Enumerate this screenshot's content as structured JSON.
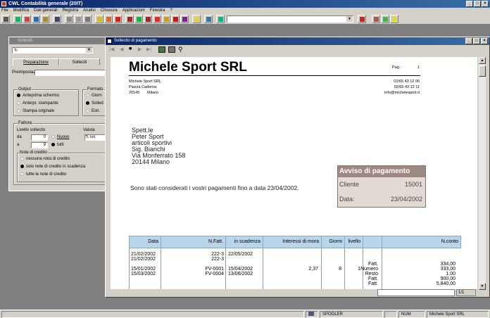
{
  "app": {
    "title": "CWL Contabilità generale (20IT)",
    "menu": [
      "File",
      "Modifica",
      "Dati generali",
      "Registra",
      "Analisi",
      "Chiusura",
      "Applicazioni",
      "Finestra",
      "?"
    ]
  },
  "statusbar": {
    "spooler": "SPOOLER",
    "num": "NUM",
    "company": "Michele Sport SRL"
  },
  "solleciti": {
    "title": "Solleciti",
    "tabs": [
      "Preparazione",
      "Solleciti"
    ],
    "preimpost_label": "Preimpostaz.",
    "output_label": "Output",
    "output_options": [
      "Anteprima schermo",
      "Anterpr. stampante",
      "Stampa originale"
    ],
    "formato_label": "Formato",
    "formato_options": [
      "Giorn",
      "Solled",
      "Estr."
    ],
    "fattura_label": "Fattura",
    "livello_label": "Livello sollecito",
    "valuta_label": "Valuta",
    "da_label": "da",
    "da_value": "0",
    "a_label": "a",
    "a_value": "9",
    "nuovo_label": "Nuovo",
    "tutti_label": "tutti",
    "valuta_value": "TL",
    "valuta_tutt": "tutt",
    "note_label": "Note di credito",
    "note_options": [
      "nessuna nota di credito",
      "solo note di credito in scadenza",
      "tutte le note di credito"
    ]
  },
  "doc": {
    "window_title": "Sollecito di pagamento",
    "company": "Michele Sport SRL",
    "pag_label": "Pag.:",
    "pag_value": "1",
    "addr1": "Michele Sport SRL",
    "addr2": "Piazza Cadorna",
    "addr3a": "20145",
    "addr3b": "Milano",
    "phone1": "02/65 43 12 06",
    "phone2": "02/65 43 12 11",
    "email": "info@michelesport.it",
    "recipient": [
      "Spett.le",
      "Peter Sport",
      "articoli sportivi",
      "Sig. Bianchi",
      "Via Monferrato 158",
      "20144 Milano"
    ],
    "body": "Sono stati considerati i vostri pagamenti fino a data 23/04/2002.",
    "avviso_title": "Avviso di pagamento",
    "cliente_label": "Cliente",
    "cliente_value": "15001",
    "data_label": "Data:",
    "data_value": "23/04/2002",
    "table_headers": [
      "Data",
      "N.Fatt.",
      "in scadenza",
      "Interessi di mora",
      "Giorni",
      "livello",
      "",
      "N.conto"
    ],
    "rows": [
      {
        "data": "21/02/2002",
        "nfatt": "222-3",
        "scad": "22/05/2002",
        "int": "",
        "giorni": "",
        "liv": "",
        "tipo": "Fatt.",
        "conto": "334,00"
      },
      {
        "data": "21/02/2002",
        "nfatt": "222-3",
        "scad": "",
        "int": "",
        "giorni": "",
        "liv": "",
        "tipo": "Numero",
        "conto": "333,00"
      },
      {
        "data": "",
        "nfatt": "",
        "scad": "",
        "int": "",
        "giorni": "",
        "liv": "",
        "tipo": "Resto",
        "conto": "1,00"
      },
      {
        "data": "15/01/2002",
        "nfatt": "FV-0001",
        "scad": "15/04/2002",
        "int": "2,37",
        "giorni": "8",
        "liv": "1",
        "tipo": "Fatt.",
        "conto": "900,00"
      },
      {
        "data": "15/03/2002",
        "nfatt": "FV-0004",
        "scad": "13/06/2002",
        "int": "",
        "giorni": "",
        "liv": "",
        "tipo": "Fatt.",
        "conto": "5.840,00"
      }
    ],
    "page_counter": "1/1"
  }
}
